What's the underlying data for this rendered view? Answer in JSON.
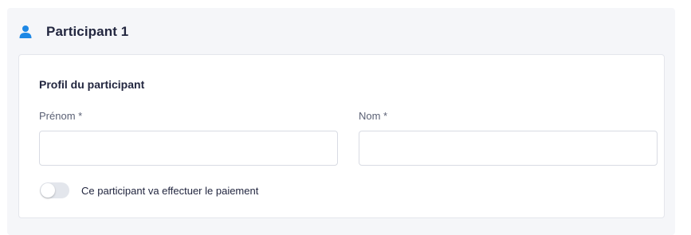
{
  "participant": {
    "title": "Participant 1",
    "icon": "person-icon",
    "accent_color": "#1e88e5"
  },
  "profile": {
    "section_title": "Profil du participant",
    "first_name": {
      "label": "Prénom *",
      "value": "",
      "placeholder": ""
    },
    "last_name": {
      "label": "Nom *",
      "value": "",
      "placeholder": ""
    },
    "payer_toggle": {
      "label": "Ce participant va effectuer le paiement",
      "checked": false
    }
  }
}
